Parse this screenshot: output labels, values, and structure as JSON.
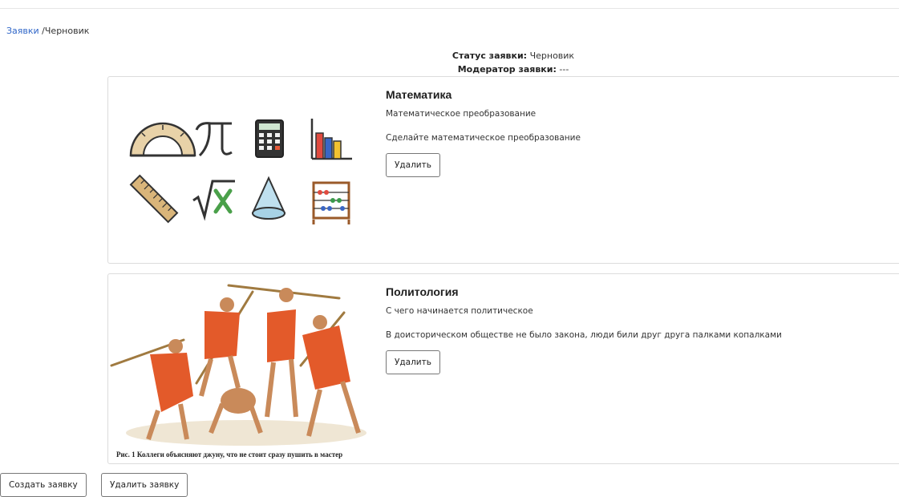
{
  "breadcrumb": {
    "link": "Заявки",
    "separator": " /",
    "current": "Черновик"
  },
  "status": {
    "label": "Статус заявки:",
    "value": " Черновик",
    "moderator_label": "Модератор заявки:",
    "moderator_value": " ---"
  },
  "cards": [
    {
      "title": "Математика",
      "subtitle": "Математическое преобразование",
      "description": "Сделайте математическое преобразование",
      "button": "Удалить",
      "icons": [
        "protractor-icon",
        "pi-icon",
        "calculator-icon",
        "bar-chart-icon",
        "ruler-icon",
        "square-root-icon",
        "cone-icon",
        "abacus-icon"
      ]
    },
    {
      "title": "Политология",
      "subtitle": "С чего начинается политическое",
      "description": "В доисторическом обществе не было закона, люди били друг друга палками копалками",
      "button": "Удалить",
      "caption": "Рис. 1 Коллеги объясняют джуну, что не стоит сразу пушить в мастер"
    }
  ],
  "actions": {
    "create": "Создать заявку",
    "delete": "Удалить заявку"
  }
}
